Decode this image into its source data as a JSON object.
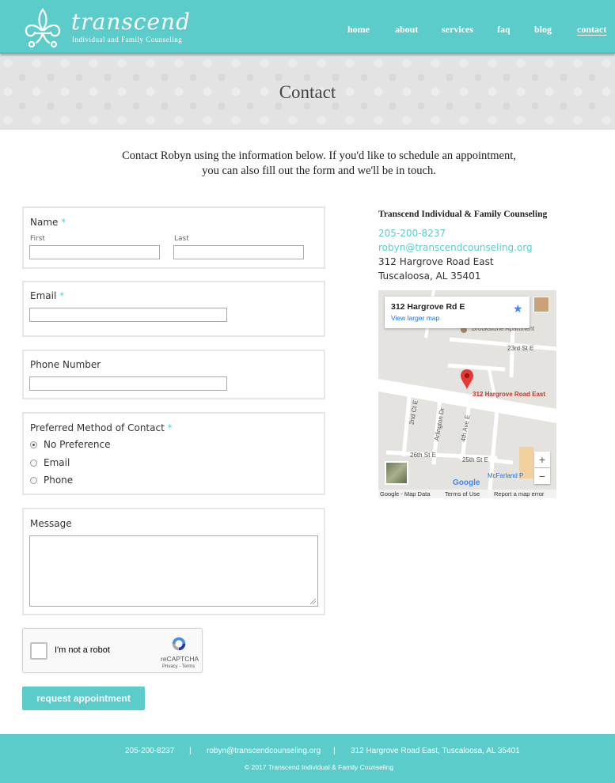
{
  "brand": {
    "name": "transcend",
    "tagline": "Individual and Family Counseling",
    "color_primary": "#5ccccb"
  },
  "nav": {
    "items": [
      {
        "label": "home"
      },
      {
        "label": "about"
      },
      {
        "label": "services"
      },
      {
        "label": "faq"
      },
      {
        "label": "blog"
      },
      {
        "label": "contact",
        "active": true
      }
    ]
  },
  "page": {
    "title": "Contact",
    "intro_line1": "Contact Robyn using the information below. If you'd like to schedule an appointment,",
    "intro_line2": "you can also fill out the form and we'll be in touch."
  },
  "form": {
    "name": {
      "label": "Name",
      "required_mark": "*",
      "first_label": "First",
      "first_value": "",
      "last_label": "Last",
      "last_value": ""
    },
    "email": {
      "label": "Email",
      "required_mark": "*",
      "value": ""
    },
    "phone": {
      "label": "Phone Number",
      "value": ""
    },
    "contact_method": {
      "label": "Preferred Method of Contact",
      "required_mark": "*",
      "options": [
        "No Preference",
        "Email",
        "Phone"
      ],
      "selected": "No Preference"
    },
    "message": {
      "label": "Message",
      "value": ""
    },
    "recaptcha": {
      "label": "I'm not a robot",
      "brand": "reCAPTCHA",
      "terms": "Privacy - Terms",
      "icon": "recaptcha-icon"
    },
    "submit_label": "request appointment"
  },
  "contact_info": {
    "org_name": "Transcend Individual & Family Counseling",
    "phone": "205-200-8237",
    "email": "robyn@transcendcounseling.org",
    "address_line1": "312 Hargrove Road East",
    "address_line2": "Tuscaloosa, AL 35401"
  },
  "map": {
    "card_title": "312 Hargrove Rd E",
    "card_link": "View larger map",
    "pin_label": "312 Hargrove Road East",
    "labels": {
      "brookstone": "Brookstone Apartment",
      "st23": "23rd St E",
      "st26": "26th St E",
      "st25": "25th St E",
      "ct2nd": "2nd Ct E",
      "arlington": "Arlington Dr",
      "ave4th": "4th Ave E",
      "mcfarland": "McFarland P"
    },
    "zoom_in": "+",
    "zoom_out": "−",
    "google": "Google",
    "footer_data": "Google - Map Data",
    "footer_terms": "Terms of Use",
    "footer_report": "Report a map error"
  },
  "footer": {
    "phone": "205-200-8237",
    "email": "robyn@transcendcounseling.org",
    "address": "312 Hargrove Road East, Tuscaloosa, AL 35401",
    "separator": "|",
    "copyright": "© 2017 Transcend Individual & Family Counseling"
  }
}
